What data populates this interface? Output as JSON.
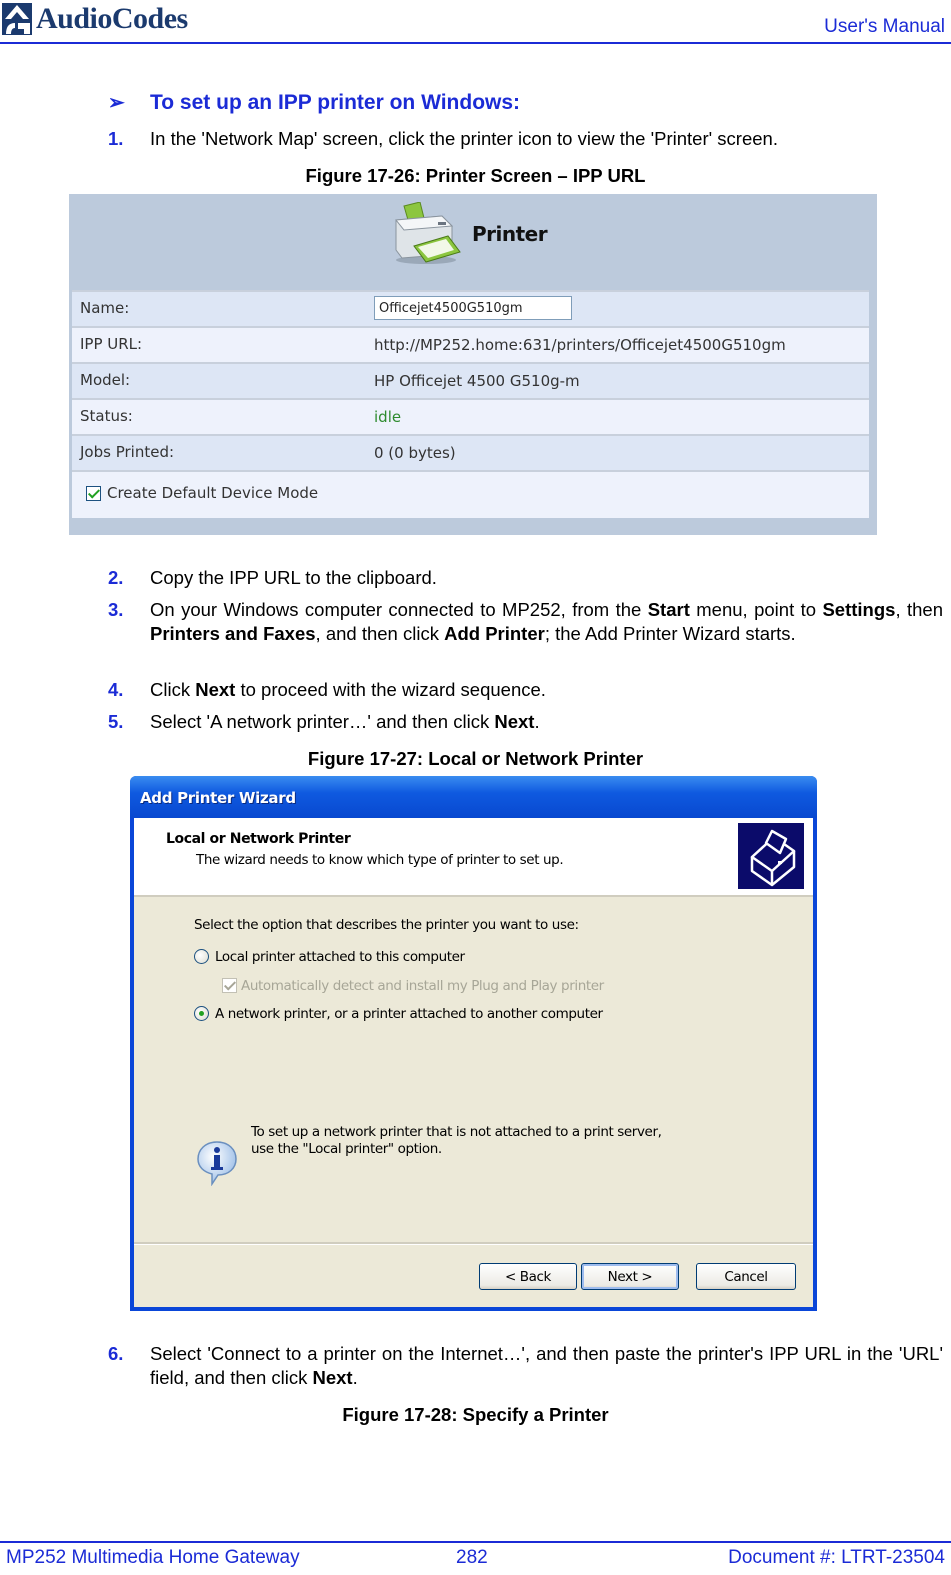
{
  "header": {
    "brand": "AudioCodes",
    "section": "User's Manual"
  },
  "procedure": {
    "heading": "To set up an IPP printer on Windows:",
    "arrow_icon": "arrow-right-icon"
  },
  "steps": [
    {
      "num": "1.",
      "text": "In the 'Network Map' screen, click the printer icon to view the 'Printer' screen."
    },
    {
      "num": "2.",
      "text": "Copy the IPP URL to the clipboard."
    },
    {
      "num": "3.",
      "parts": [
        "On your Windows computer connected to MP252, from the ",
        "Start",
        " menu, point to ",
        "Settings",
        ", then ",
        "Printers and Faxes",
        ", and then click ",
        "Add Printer",
        "; the Add Printer Wizard starts."
      ]
    },
    {
      "num": "4.",
      "parts": [
        "Click ",
        "Next",
        " to proceed with the wizard sequence."
      ]
    },
    {
      "num": "5.",
      "parts": [
        "Select 'A network printer…' and then click ",
        "Next",
        "."
      ]
    },
    {
      "num": "6.",
      "parts": [
        "Select 'Connect to a printer on the Internet…', and then paste the printer's IPP URL in the 'URL' field, and then click ",
        "Next",
        "."
      ]
    }
  ],
  "figures": {
    "fig1_caption": "Figure 17-26: Printer Screen – IPP URL",
    "fig2_caption": "Figure 17-27: Local or Network Printer",
    "fig3_caption": "Figure 17-28: Specify a Printer"
  },
  "printer_screen": {
    "title": "Printer",
    "rows": [
      {
        "label": "Name:",
        "value": "Officejet4500G510gm"
      },
      {
        "label": "IPP URL:",
        "value": "http://MP252.home:631/printers/Officejet4500G510gm"
      },
      {
        "label": "Model:",
        "value": "HP Officejet 4500 G510g-m"
      },
      {
        "label": "Status:",
        "value": "idle"
      },
      {
        "label": "Jobs Printed:",
        "value": "0 (0 bytes)"
      }
    ],
    "checkbox_label": "Create Default Device Mode",
    "checkbox_checked": true,
    "status_color": "#2e8b2e"
  },
  "wizard": {
    "window_title": "Add Printer Wizard",
    "header_title": "Local or Network Printer",
    "header_subtitle": "The wizard needs to know which type of printer to set up.",
    "prompt": "Select the option that describes the printer you want to use:",
    "option_local": "Local printer attached to this computer",
    "option_local_selected": false,
    "auto_detect": "Automatically detect and install my Plug and Play printer",
    "auto_detect_checked": true,
    "option_network": "A network printer, or a printer attached to another computer",
    "option_network_selected": true,
    "info_line1": "To set up a network printer that is not attached to a print server,",
    "info_line2": "use the \"Local printer\" option.",
    "back_label": "< Back",
    "next_label": "Next >",
    "cancel_label": "Cancel"
  },
  "footer": {
    "product": "MP252 Multimedia Home Gateway",
    "page": "282",
    "document": "Document #: LTRT-23504"
  },
  "colors": {
    "accent_blue": "#1b2bd6",
    "brand_navy": "#1b3a6e",
    "xp_title_blue": "#0a46d8"
  }
}
